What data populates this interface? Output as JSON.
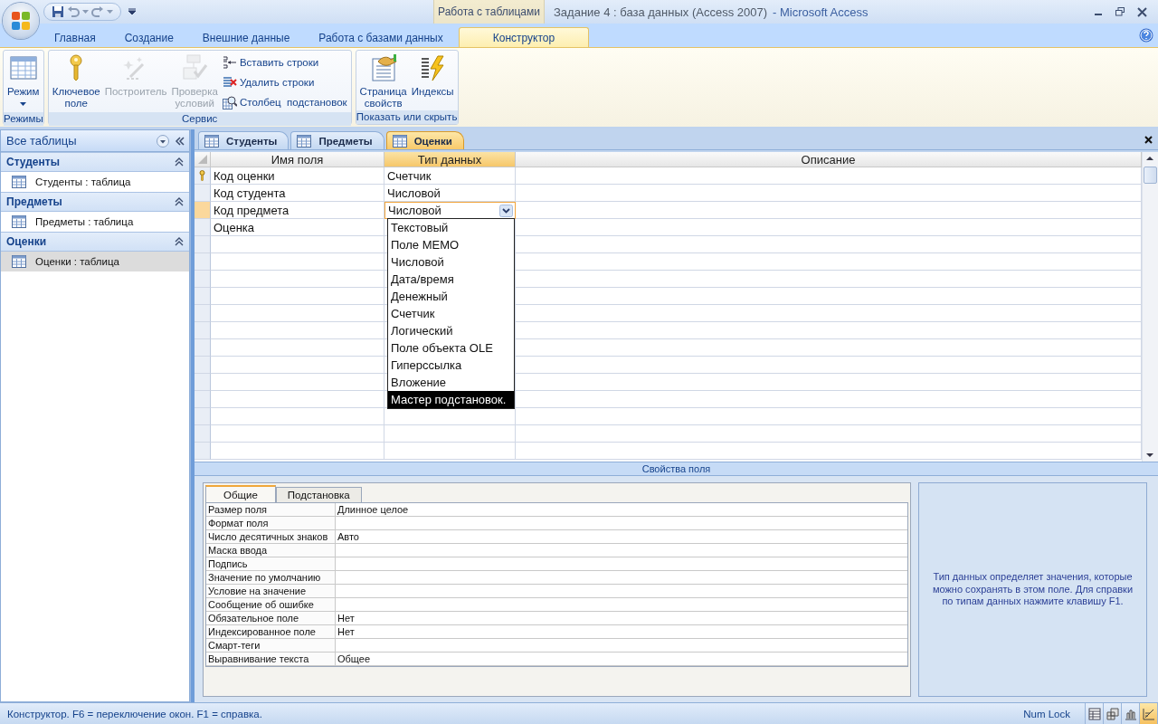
{
  "window": {
    "title": "Задание 4 : база данных (Access 2007)",
    "app_name": "- Microsoft Access",
    "contextual_group": "Работа с таблицами"
  },
  "ribbon_tabs": [
    {
      "label": "Главная",
      "selected": false
    },
    {
      "label": "Создание",
      "selected": false
    },
    {
      "label": "Внешние данные",
      "selected": false
    },
    {
      "label": "Работа с базами данных",
      "selected": false
    },
    {
      "label": "Конструктор",
      "selected": true
    }
  ],
  "ribbon_groups": [
    {
      "label": "Режимы",
      "buttons": [
        {
          "kind": "large",
          "label": "Режим",
          "disabled": false,
          "has_menu": true
        }
      ]
    },
    {
      "label": "Сервис",
      "buttons": [
        {
          "kind": "large",
          "label": "Ключевое\nполе",
          "disabled": false
        },
        {
          "kind": "large",
          "label": "Построитель",
          "disabled": true
        },
        {
          "kind": "large",
          "label": "Проверка\nусловий",
          "disabled": true
        },
        {
          "kind": "small",
          "label": "Вставить строки",
          "disabled": false
        },
        {
          "kind": "small",
          "label": "Удалить строки",
          "disabled": false
        },
        {
          "kind": "small",
          "label": "Столбец  подстановок",
          "disabled": false
        }
      ]
    },
    {
      "label": "Показать или скрыть",
      "buttons": [
        {
          "kind": "large",
          "label": "Страница\nсвойств",
          "disabled": false
        },
        {
          "kind": "large",
          "label": "Индексы",
          "disabled": false
        }
      ]
    }
  ],
  "navigation": {
    "title": "Все таблицы",
    "groups": [
      {
        "title": "Студенты",
        "expanded": true,
        "items": [
          {
            "label": "Студенты : таблица",
            "selected": false
          }
        ]
      },
      {
        "title": "Предметы",
        "expanded": true,
        "items": [
          {
            "label": "Предметы : таблица",
            "selected": false
          }
        ]
      },
      {
        "title": "Оценки",
        "expanded": true,
        "items": [
          {
            "label": "Оценки : таблица",
            "selected": true
          }
        ]
      }
    ]
  },
  "document_tabs": [
    {
      "label": "Студенты",
      "selected": false
    },
    {
      "label": "Предметы",
      "selected": false
    },
    {
      "label": "Оценки",
      "selected": true
    }
  ],
  "field_grid": {
    "columns": [
      {
        "label": "Имя поля",
        "selected": false
      },
      {
        "label": "Тип данных",
        "selected": true
      },
      {
        "label": "Описание",
        "selected": false
      }
    ],
    "rows": [
      {
        "name": "Код оценки",
        "type": "Счетчик",
        "primary_key": true,
        "current": false
      },
      {
        "name": "Код студента",
        "type": "Числовой",
        "primary_key": false,
        "current": false
      },
      {
        "name": "Код предмета",
        "type": "Числовой",
        "primary_key": false,
        "current": true
      },
      {
        "name": "Оценка",
        "type": "",
        "primary_key": false,
        "current": false
      }
    ],
    "type_dropdown": [
      {
        "label": "Текстовый",
        "selected": false
      },
      {
        "label": "Поле MEMO",
        "selected": false
      },
      {
        "label": "Числовой",
        "selected": false
      },
      {
        "label": "Дата/время",
        "selected": false
      },
      {
        "label": "Денежный",
        "selected": false
      },
      {
        "label": "Счетчик",
        "selected": false
      },
      {
        "label": "Логический",
        "selected": false
      },
      {
        "label": "Поле объекта OLE",
        "selected": false
      },
      {
        "label": "Гиперссылка",
        "selected": false
      },
      {
        "label": "Вложение",
        "selected": false
      },
      {
        "label": "Мастер подстановок.",
        "selected": true
      }
    ]
  },
  "field_properties": {
    "title": "Свойства поля",
    "tabs": [
      {
        "label": "Общие",
        "selected": true
      },
      {
        "label": "Подстановка",
        "selected": false
      }
    ],
    "rows": [
      {
        "label": "Размер поля",
        "value": "Длинное целое"
      },
      {
        "label": "Формат поля",
        "value": ""
      },
      {
        "label": "Число десятичных знаков",
        "value": "Авто"
      },
      {
        "label": "Маска ввода",
        "value": ""
      },
      {
        "label": "Подпись",
        "value": ""
      },
      {
        "label": "Значение по умолчанию",
        "value": ""
      },
      {
        "label": "Условие на значение",
        "value": ""
      },
      {
        "label": "Сообщение об ошибке",
        "value": ""
      },
      {
        "label": "Обязательное поле",
        "value": "Нет"
      },
      {
        "label": "Индексированное поле",
        "value": "Нет"
      },
      {
        "label": "Смарт-теги",
        "value": ""
      },
      {
        "label": "Выравнивание текста",
        "value": "Общее"
      }
    ],
    "help": "Тип данных определяет значения, которые можно сохранять в этом поле.  Для справки по типам данных нажмите клавишу F1."
  },
  "status_bar": {
    "text": "Конструктор.  F6 = переключение окон.  F1 = справка.",
    "indicator": "Num Lock",
    "view_buttons": [
      {
        "selected": false
      },
      {
        "selected": false
      },
      {
        "selected": false
      },
      {
        "selected": true
      }
    ]
  }
}
